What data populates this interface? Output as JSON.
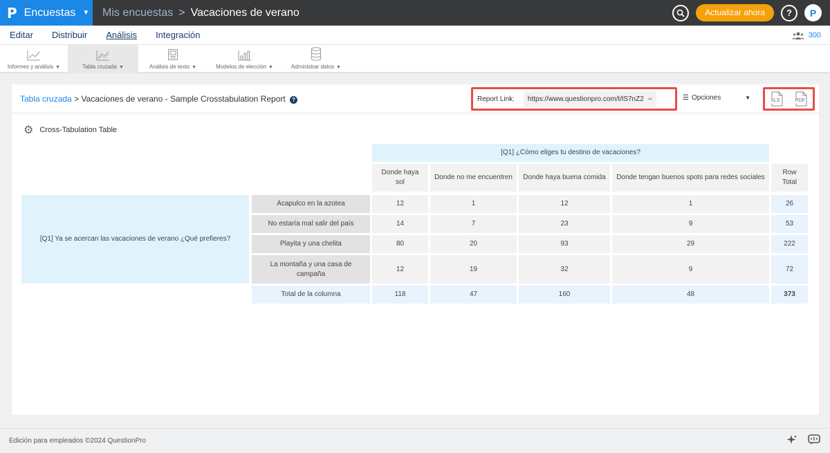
{
  "header": {
    "brand_logo": "P",
    "brand_name": "Encuestas",
    "breadcrumb_parent": "Mis encuestas",
    "breadcrumb_separator": ">",
    "breadcrumb_current": "Vacaciones de verano",
    "upgrade_label": "Actualizar ahora",
    "help_label": "?",
    "profile_label": "P"
  },
  "mainnav": {
    "items": [
      {
        "label": "Editar"
      },
      {
        "label": "Distribuir"
      },
      {
        "label": "Análisis"
      },
      {
        "label": "Integración"
      }
    ],
    "active": "Análisis",
    "users_count": "300"
  },
  "toolbar": {
    "items": [
      {
        "label": "Informes y análisis",
        "icon": "line-chart-icon"
      },
      {
        "label": "Tabla cruzada",
        "icon": "crosstab-chart-icon"
      },
      {
        "label": "Análisis de texto",
        "icon": "text-analysis-icon"
      },
      {
        "label": "Modelos de elección",
        "icon": "bar-chart-icon"
      },
      {
        "label": "Administrar datos",
        "icon": "database-icon"
      }
    ],
    "active": "Tabla cruzada"
  },
  "card": {
    "breadcrumb_link": "Tabla cruzada",
    "breadcrumb_sep": ">",
    "breadcrumb_title": "Vacaciones de verano - Sample Crosstabulation Report",
    "help_label": "?",
    "report_link_label": "Report Link:",
    "report_link_url": "https://www.questionpro.com/t/lS7nZ2",
    "options_label": "Opciones",
    "export_xls": "XLS",
    "export_pdf": "PDF",
    "section_title": "Cross-Tabulation Table"
  },
  "crosstab": {
    "column_question": "[Q1] ¿Cómo eliges tu destino de vacaciones?",
    "columns": [
      "Donde haya sol",
      "Donde no me encuentren",
      "Donde haya buena comida",
      "Donde tengan buenos spots para redes sociales"
    ],
    "row_total_label": "Row Total",
    "row_question": "[Q1] Ya se acercan las vacaciones de verano ¿Qué prefieres?",
    "rows": [
      {
        "label": "Acapulco en la azotea",
        "values": [
          "12",
          "1",
          "12",
          "1"
        ],
        "total": "26"
      },
      {
        "label": "No estaría mal salir del país",
        "values": [
          "14",
          "7",
          "23",
          "9"
        ],
        "total": "53"
      },
      {
        "label": "Playita y una chelita",
        "values": [
          "80",
          "20",
          "93",
          "29"
        ],
        "total": "222"
      },
      {
        "label": "La montaña y una casa de campaña",
        "values": [
          "12",
          "19",
          "32",
          "9"
        ],
        "total": "72"
      }
    ],
    "column_total": {
      "label": "Total de la columna",
      "values": [
        "118",
        "47",
        "160",
        "48"
      ],
      "total": "373"
    }
  },
  "footer": {
    "copyright": "Edición para empleados ©2024 QuestionPro"
  }
}
